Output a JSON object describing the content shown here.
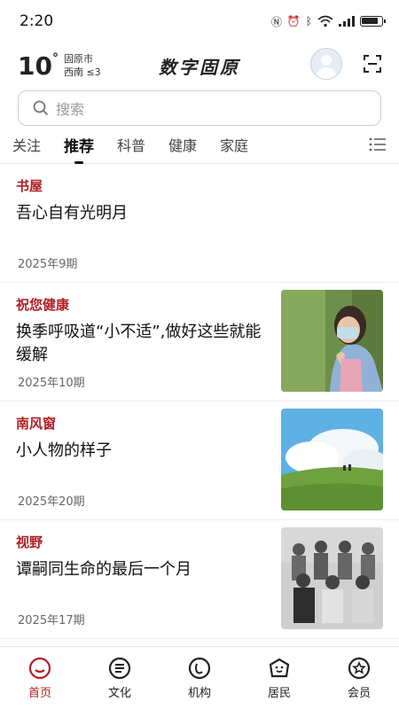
{
  "status_bar": {
    "time": "2:20"
  },
  "header": {
    "temperature": "10",
    "degree": "°",
    "city": "固原市",
    "wind": "西南  ≤3",
    "app_title": "数字固原"
  },
  "search": {
    "placeholder": "搜索"
  },
  "tabs": [
    {
      "label": "关注"
    },
    {
      "label": "推荐"
    },
    {
      "label": "科普"
    },
    {
      "label": "健康"
    },
    {
      "label": "家庭"
    }
  ],
  "feed": [
    {
      "source": "书屋",
      "title": "吾心自有光明月",
      "issue": "2025年9期"
    },
    {
      "source": "祝您健康",
      "title": "换季呼吸道“小不适”,做好这些就能缓解",
      "issue": "2025年10期"
    },
    {
      "source": "南风窗",
      "title": "小人物的样子",
      "issue": "2025年20期"
    },
    {
      "source": "视野",
      "title": "谭嗣同生命的最后一个月",
      "issue": "2025年17期"
    }
  ],
  "bottom_nav": [
    {
      "label": "首页",
      "icon": "home-icon"
    },
    {
      "label": "文化",
      "icon": "culture-icon"
    },
    {
      "label": "机构",
      "icon": "institution-icon"
    },
    {
      "label": "居民",
      "icon": "resident-icon"
    },
    {
      "label": "会员",
      "icon": "member-icon"
    }
  ],
  "colors": {
    "accent": "#b01f24"
  }
}
